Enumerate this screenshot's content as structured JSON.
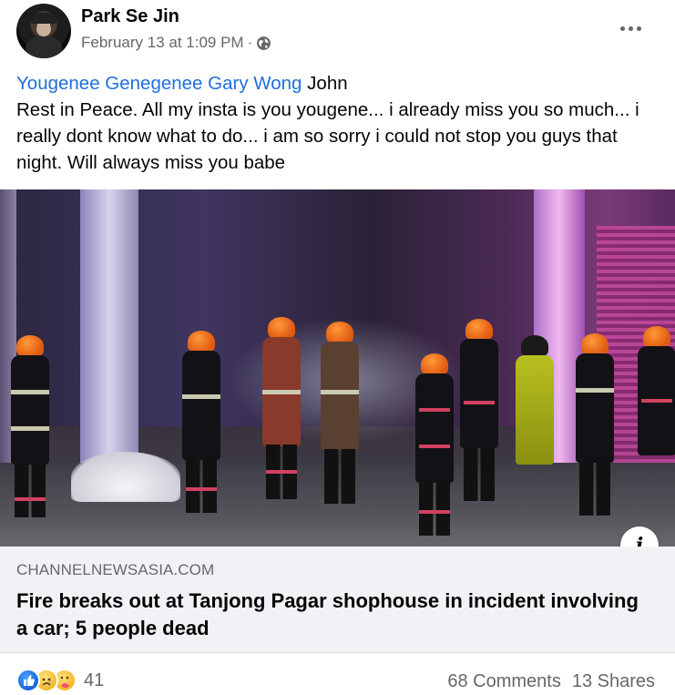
{
  "post": {
    "author": "Park Se Jin",
    "timestamp": "February 13 at 1:09 PM",
    "separator": "·",
    "privacy_icon": "globe-icon",
    "more_icon": "more-horizontal-icon",
    "caption": {
      "tags": [
        "Yougenee Genegenee",
        "Gary Wong"
      ],
      "tag_separator": " ",
      "after_tags": " John",
      "body": "Rest in Peace. All my insta is you yougene... i already miss you so much... i really dont know what to do... i am so sorry i could not stop you guys that night. Will always miss you babe"
    },
    "image": {
      "description_icon": "info-icon",
      "info_label": "i"
    },
    "link_preview": {
      "domain": "CHANNELNEWSASIA.COM",
      "title": "Fire breaks out at Tanjong Pagar shophouse in incident involving a car; 5 people dead"
    },
    "footer": {
      "reaction_icons": [
        "like-icon",
        "sad-icon",
        "care-icon"
      ],
      "reaction_count": "41",
      "comments": "68 Comments",
      "shares": "13 Shares"
    }
  },
  "colors": {
    "link_blue": "#216fdb",
    "secondary_text": "#65676b",
    "card_bg": "#f0f2f5"
  }
}
